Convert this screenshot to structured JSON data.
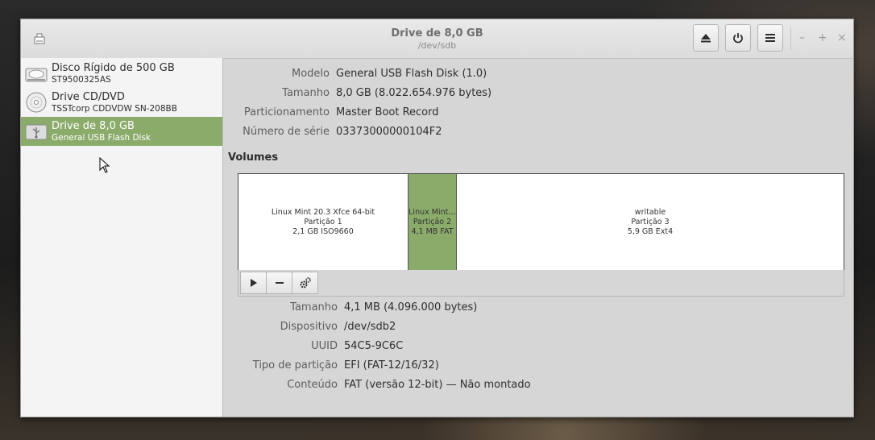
{
  "window": {
    "title": "Drive de 8,0 GB",
    "subtitle": "/dev/sdb",
    "buttons": {
      "eject_icon": "eject-icon",
      "power_icon": "power-icon",
      "menu_icon": "hamburger-menu-icon"
    },
    "wm": {
      "minimize": "–",
      "maximize": "+",
      "close": "×"
    }
  },
  "sidebar": {
    "drives": [
      {
        "name": "Disco Rígido de 500 GB",
        "sub": "ST9500325AS",
        "icon": "hard-disk-icon"
      },
      {
        "name": "Drive CD/DVD",
        "sub": "TSSTcorp CDDVDW SN-208BB",
        "icon": "optical-disc-icon"
      },
      {
        "name": "Drive de 8,0 GB",
        "sub": "General USB Flash Disk",
        "icon": "usb-drive-icon"
      }
    ]
  },
  "drive_props": [
    {
      "label": "Modelo",
      "value": "General USB Flash Disk (1.0)"
    },
    {
      "label": "Tamanho",
      "value": "8,0 GB (8.022.654.976 bytes)"
    },
    {
      "label": "Particionamento",
      "value": "Master Boot Record"
    },
    {
      "label": "Número de série",
      "value": "03373000000104F2"
    }
  ],
  "volumes": {
    "heading": "Volumes",
    "partitions": [
      {
        "line1": "Linux Mint 20.3 Xfce 64-bit",
        "line2": "Partição 1",
        "line3": "2,1 GB ISO9660"
      },
      {
        "line1": "Linux Mint…",
        "line2": "Partição 2",
        "line3": "4,1 MB FAT"
      },
      {
        "line1": "writable",
        "line2": "Partição 3",
        "line3": "5,9 GB Ext4"
      }
    ],
    "toolbar": {
      "play_icon": "play-icon",
      "remove_icon": "minus-icon",
      "settings_icon": "gears-icon"
    }
  },
  "volume_props": [
    {
      "label": "Tamanho",
      "value": "4,1 MB (4.096.000 bytes)"
    },
    {
      "label": "Dispositivo",
      "value": "/dev/sdb2"
    },
    {
      "label": "UUID",
      "value": "54C5-9C6C"
    },
    {
      "label": "Tipo de partição",
      "value": "EFI (FAT-12/16/32)"
    },
    {
      "label": "Conteúdo",
      "value": "FAT (versão 12-bit) — Não montado"
    }
  ],
  "colors": {
    "selection": "#8bab6b",
    "window_bg": "#d6d6d6"
  }
}
